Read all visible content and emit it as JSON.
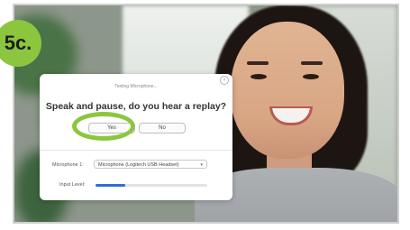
{
  "step_badge": "5c.",
  "dialog": {
    "title": "Testing Microphone...",
    "question": "Speak and pause, do you hear a replay?",
    "yes_label": "Yes",
    "no_label": "No",
    "microphone_label": "Microphone 1:",
    "microphone_value": "Microphone (Logitech USB Headset)",
    "input_level_label": "Input Level:",
    "input_level_fraction": 0.27
  },
  "colors": {
    "highlight": "#8cc63f",
    "level_fill": "#2d6fd1"
  }
}
